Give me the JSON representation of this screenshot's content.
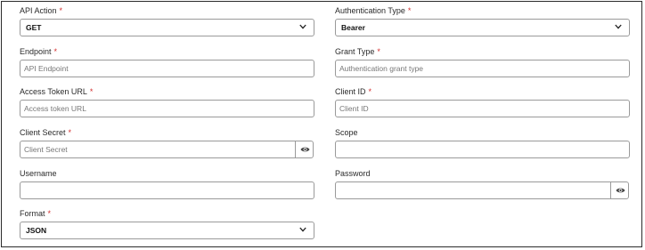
{
  "fields": {
    "api_action": {
      "label": "API Action",
      "required": "*",
      "value": "GET"
    },
    "auth_type": {
      "label": "Authentication Type",
      "required": "*",
      "value": "Bearer"
    },
    "endpoint": {
      "label": "Endpoint",
      "required": "*",
      "placeholder": "API Endpoint"
    },
    "grant_type": {
      "label": "Grant Type",
      "required": "*",
      "placeholder": "Authentication grant type"
    },
    "access_token_url": {
      "label": "Access Token URL",
      "required": "*",
      "placeholder": "Access token URL"
    },
    "client_id": {
      "label": "Client ID",
      "required": "*",
      "placeholder": "Client ID"
    },
    "client_secret": {
      "label": "Client Secret",
      "required": "*",
      "placeholder": "Client Secret"
    },
    "scope": {
      "label": "Scope",
      "placeholder": ""
    },
    "username": {
      "label": "Username",
      "placeholder": ""
    },
    "password": {
      "label": "Password",
      "placeholder": ""
    },
    "format": {
      "label": "Format",
      "required": "*",
      "value": "JSON"
    }
  },
  "icons": {
    "select_arrow": "chevron-down-icon",
    "show_password": "eye-icon"
  },
  "colors": {
    "required_marker": "#d32f2f",
    "border": "#9a9a9a"
  }
}
